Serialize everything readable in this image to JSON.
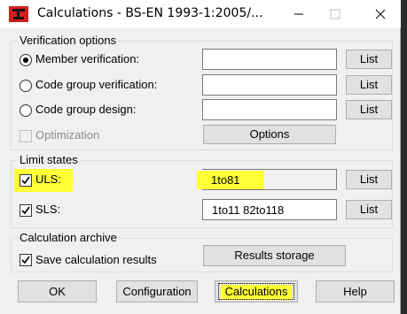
{
  "window": {
    "title": "Calculations - BS-EN 1993-1:2005/..."
  },
  "verification": {
    "group_title": "Verification options",
    "member_label": "Member verification:",
    "code_group_verification_label": "Code group verification:",
    "code_group_design_label": "Code group design:",
    "optimization_label": "Optimization",
    "list_label": "List",
    "options_label": "Options",
    "selected": "Member verification"
  },
  "limit_states": {
    "group_title": "Limit states",
    "uls_label": "ULS:",
    "uls_value": "1to81",
    "sls_label": "SLS:",
    "sls_value": "1to11 82to118",
    "list_label": "List"
  },
  "archive": {
    "group_title": "Calculation archive",
    "save_label": "Save calculation results",
    "results_storage_label": "Results storage"
  },
  "footer": {
    "ok_label": "OK",
    "configuration_label": "Configuration",
    "calculations_label": "Calculations",
    "help_label": "Help"
  },
  "colors": {
    "highlight": "#ffff35",
    "app_icon_red": "#d31f1f"
  }
}
